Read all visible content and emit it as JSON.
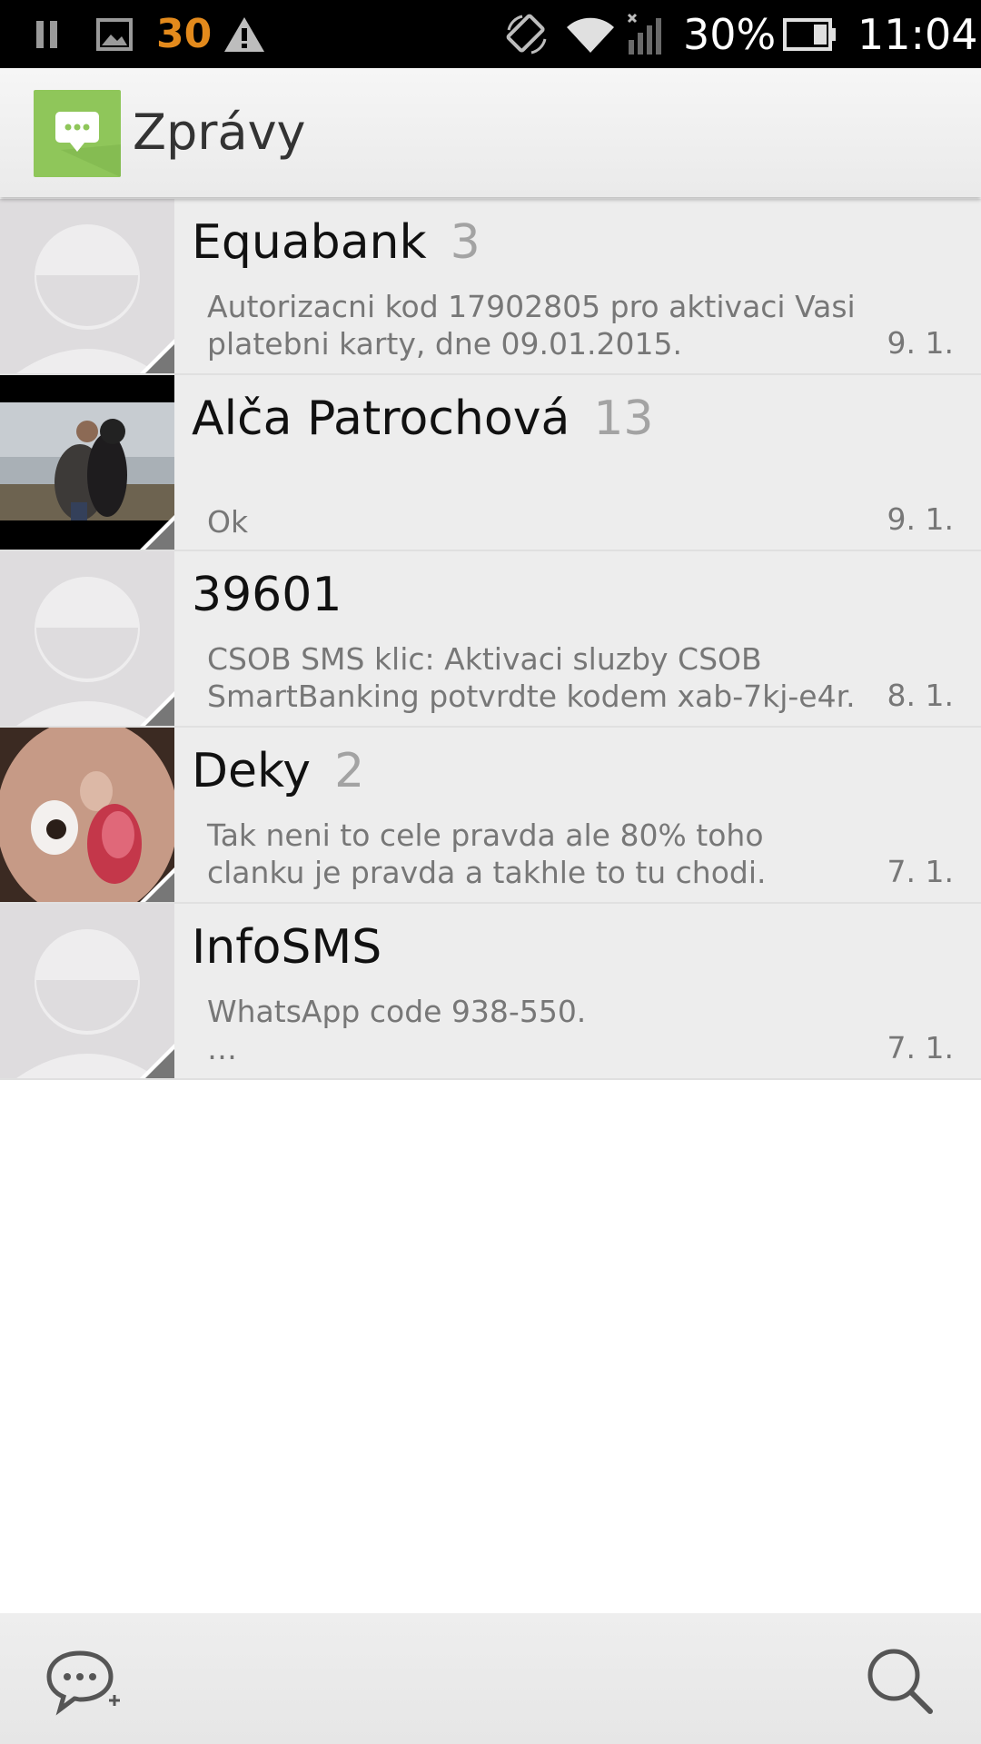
{
  "status_bar": {
    "notification_count": "30",
    "battery": "30%",
    "time": "11:04",
    "icons": [
      "pause-icon",
      "image-notification-icon",
      "warning-icon",
      "screen-rotation-icon",
      "wifi-icon",
      "signal-icon",
      "battery-icon"
    ]
  },
  "app": {
    "title": "Zprávy",
    "accent_color": "#8fc65a"
  },
  "conversations": [
    {
      "name": "Equabank",
      "count": "3",
      "snippet": "Autorizacni kod 17902805 pro aktivaci Vasi platebni karty, dne 09.01.2015.",
      "date": "9. 1.",
      "avatar": "default-avatar"
    },
    {
      "name": "Alča Patrochová",
      "count": "13",
      "snippet": "Ok",
      "date": "9. 1.",
      "avatar": "photo-avatar"
    },
    {
      "name": "39601",
      "count": "",
      "snippet": "CSOB SMS klic: Aktivaci sluzby CSOB SmartBanking potvrdte kodem xab-7kj-e4r.",
      "date": "8. 1.",
      "avatar": "default-avatar"
    },
    {
      "name": "Deky",
      "count": "2",
      "snippet": "Tak neni to cele pravda ale 80% toho clanku je pravda a takhle to tu chodi.",
      "date": "7. 1.",
      "avatar": "photo-avatar"
    },
    {
      "name": "InfoSMS",
      "count": "",
      "snippet": "WhatsApp code 938-550.\n…",
      "date": "7. 1.",
      "avatar": "default-avatar"
    }
  ],
  "bottom_bar": {
    "icons": [
      "new-message-icon",
      "search-icon"
    ]
  }
}
